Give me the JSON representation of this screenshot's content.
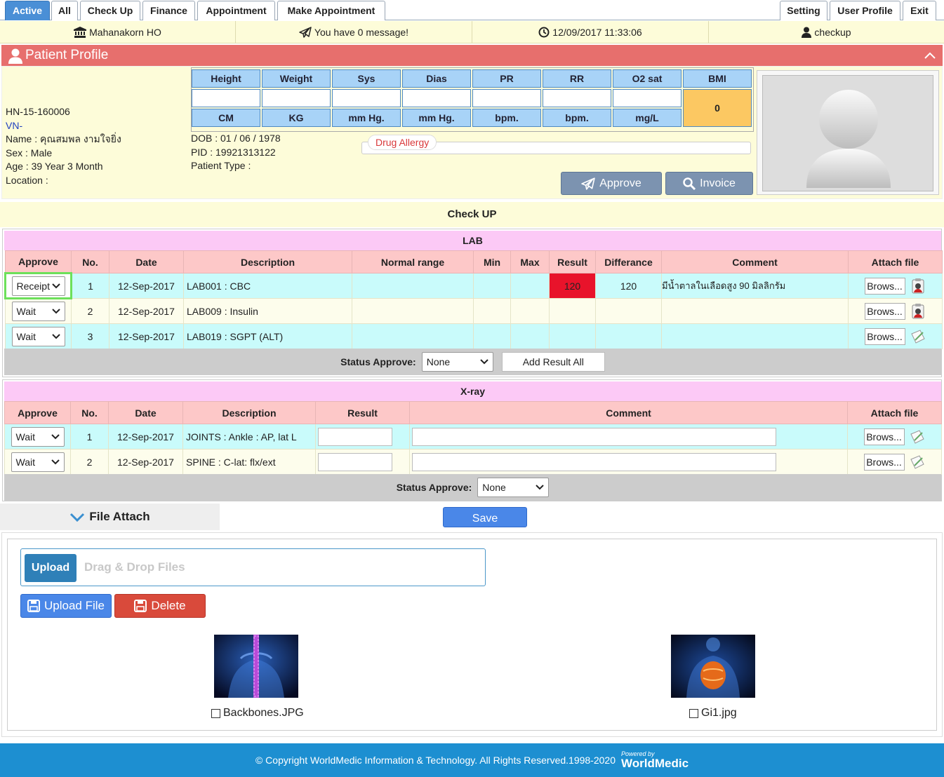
{
  "nav": {
    "left_tabs": [
      "Active",
      "All",
      "Check Up",
      "Finance",
      "Appointment",
      "Make Appointment"
    ],
    "right_tabs": [
      "Setting",
      "User Profile",
      "Exit"
    ]
  },
  "infobar": {
    "branch": "Mahanakorn HO",
    "message": "You have 0 message!",
    "datetime": "12/09/2017 11:33:06",
    "user": "checkup"
  },
  "profile": {
    "title": "Patient Profile",
    "hn": "HN-15-160006",
    "vn": "VN-",
    "name": "Name : คุณสมพล งามใจยิ่ง",
    "sex": "Sex : Male",
    "age": "Age : 39 Year 3 Month",
    "location": "Location :",
    "dob": "DOB : 01 / 06 / 1978",
    "pid": "PID : 19921313122",
    "patient_type": "Patient Type :",
    "drug_allergy_label": "Drug Allergy",
    "approve_label": "Approve",
    "invoice_label": "Invoice"
  },
  "vitals": {
    "headers": [
      "Height",
      "Weight",
      "Sys",
      "Dias",
      "PR",
      "RR",
      "O2 sat",
      "BMI"
    ],
    "units": [
      "CM",
      "KG",
      "mm Hg.",
      "mm Hg.",
      "bpm.",
      "bpm.",
      "mg/L"
    ],
    "bmi_value": "0"
  },
  "checkup_title": "Check UP",
  "lab": {
    "title": "LAB",
    "headers": [
      "Approve",
      "No.",
      "Date",
      "Description",
      "Normal range",
      "Min",
      "Max",
      "Result",
      "Differance",
      "Comment",
      "Attach file"
    ],
    "rows": [
      {
        "approve": "Receipt",
        "no": "1",
        "date": "12-Sep-2017",
        "desc": "LAB001 : CBC",
        "result": "120",
        "diff": "120",
        "comment": "มีน้ำตาลในเลือดสูง 90 มิลลิกรัม",
        "browse": "Brows..."
      },
      {
        "approve": "Wait",
        "no": "2",
        "date": "12-Sep-2017",
        "desc": "LAB009 : Insulin",
        "result": "",
        "diff": "",
        "comment": "",
        "browse": "Brows..."
      },
      {
        "approve": "Wait",
        "no": "3",
        "date": "12-Sep-2017",
        "desc": "LAB019 : SGPT (ALT)",
        "result": "",
        "diff": "",
        "comment": "",
        "browse": "Brows..."
      }
    ],
    "status_label": "Status Approve:",
    "status_value": "None",
    "add_result_all": "Add Result All"
  },
  "xray": {
    "title": "X-ray",
    "headers": [
      "Approve",
      "No.",
      "Date",
      "Description",
      "Result",
      "Comment",
      "Attach file"
    ],
    "rows": [
      {
        "approve": "Wait",
        "no": "1",
        "date": "12-Sep-2017",
        "desc": "JOINTS : Ankle : AP, lat L",
        "browse": "Brows..."
      },
      {
        "approve": "Wait",
        "no": "2",
        "date": "12-Sep-2017",
        "desc": "SPINE : C-lat: flx/ext",
        "browse": "Brows..."
      }
    ],
    "status_label": "Status Approve:",
    "status_value": "None"
  },
  "file_attach": {
    "tab_label": "File Attach",
    "save_label": "Save",
    "upload_label": "Upload",
    "dropzone_text": "Drag & Drop Files",
    "upload_file_label": "Upload File",
    "delete_label": "Delete",
    "files": [
      "Backbones.JPG",
      "Gi1.jpg"
    ]
  },
  "footer": {
    "copyright": "© Copyright WorldMedic Information & Technology. All Rights Reserved.1998-2020",
    "powered_by": "Powered by",
    "brand": "WorldMedic"
  },
  "colors": {
    "header_red": "#e76f6d",
    "result_red": "#e8132b",
    "accent_blue": "#4a87e8",
    "footer_blue": "#1d8fd1",
    "bmi_orange": "#fcc862"
  }
}
